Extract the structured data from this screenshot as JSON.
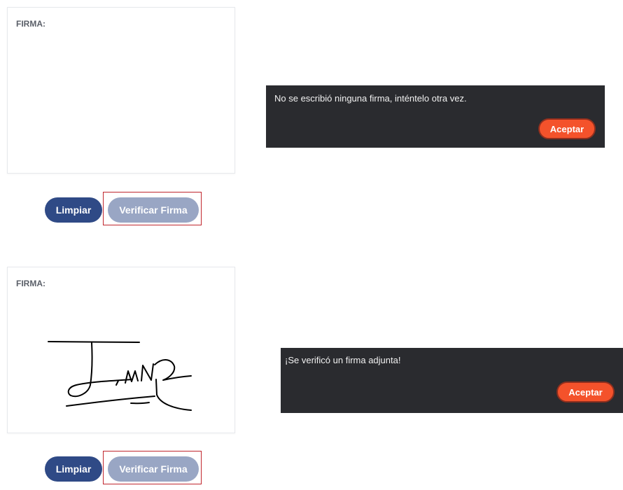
{
  "panels": [
    {
      "label": "FIRMA:",
      "has_signature": false,
      "buttons": {
        "clear_label": "Limpiar",
        "verify_label": "Verificar Firma"
      },
      "dialog": {
        "message": "No se escribió ninguna firma, inténtelo otra vez.",
        "accept_label": "Aceptar"
      }
    },
    {
      "label": "FIRMA:",
      "has_signature": true,
      "buttons": {
        "clear_label": "Limpiar",
        "verify_label": "Verificar Firma"
      },
      "dialog": {
        "message": "¡Se verificó un firma adjunta!",
        "accept_label": "Aceptar"
      }
    }
  ],
  "colors": {
    "clear_button": "#2f4a86",
    "verify_button": "#99a6c4",
    "dialog_background": "#2a2b2f",
    "accept_button": "#f4522b",
    "highlight_border": "#c0262d"
  }
}
